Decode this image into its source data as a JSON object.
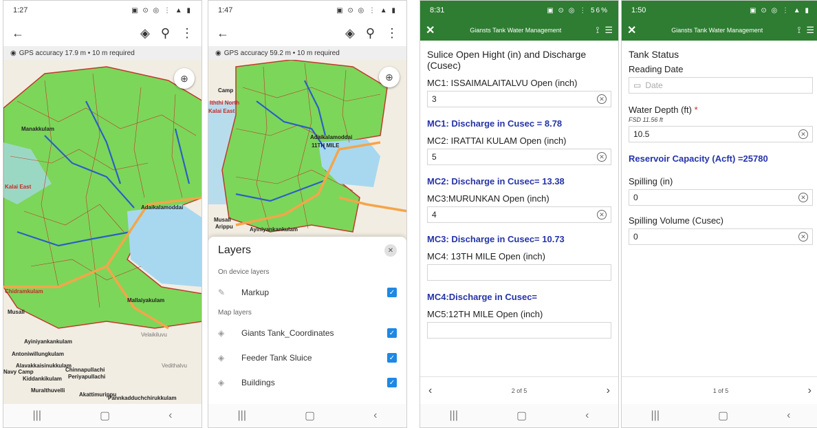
{
  "screen1": {
    "status": {
      "time": "1:27",
      "icons": "▣ ⊙ ◎ ⋮ ▲ ▮"
    },
    "gps": "GPS accuracy 17.9 m  •  10 m required",
    "labels": [
      "Manakkulam",
      "Adaikalamoddai",
      "Musali",
      "Ayiniyankankulam",
      "Antoniwillungkulam",
      "Alavakkaisinukkulam",
      "Navy Camp",
      "Kiddankikulam",
      "Chinnapullachi",
      "Periyapullachi",
      "Vedithalvu",
      "Muralthuvelli",
      "Akattimurippu",
      "Pannkadduchchirukkulam",
      "Velaikiluvu",
      "Mallaiyakulam",
      "Kalai East",
      "Chidramkulam"
    ]
  },
  "screen2": {
    "status": {
      "time": "1:47",
      "icons": "▣ ⊙ ◎ ⋮ ▲ ▮"
    },
    "gps": "GPS accuracy 59.2 m  •  10 m required",
    "labels": [
      "Camp",
      "Iththi North",
      "Kalai East",
      "Adaikalamoddai",
      "11TH MILE",
      "Musali",
      "Arippu",
      "Ayiniyankankulam"
    ],
    "sheet": {
      "title": "Layers",
      "on_device": "On device layers",
      "map_layers": "Map layers",
      "layers": [
        {
          "name": "Markup",
          "icon": "✎"
        },
        {
          "name": "Giants Tank_Coordinates",
          "icon": "◈"
        },
        {
          "name": "Feeder Tank Sluice",
          "icon": "◈"
        },
        {
          "name": "Buildings",
          "icon": "◈"
        }
      ]
    }
  },
  "screen3": {
    "status": {
      "time": "8:31",
      "icons": "▣ ⊙ ◎ ⋮ 56%"
    },
    "appbar": {
      "title": "Giansts Tank Water Management"
    },
    "header": "Sulice Open Hight (in) and Discharge (Cusec)",
    "q1": {
      "label": "MC1: ISSAIMALAITALVU Open (inch)",
      "value": "3"
    },
    "c1": "MC1: Discharge in Cusec = 8.78",
    "q2": {
      "label": "MC2: IRATTAI KULAM Open (inch)",
      "value": "5"
    },
    "c2": "MC2: Discharge in Cusec= 13.38",
    "q3": {
      "label": "MC3:MURUNKAN Open (inch)",
      "value": "4"
    },
    "c3": "MC3: Discharge in Cusec= 10.73",
    "q4": {
      "label": "MC4: 13TH MILE Open (inch)",
      "value": ""
    },
    "c4": "MC4:Discharge in Cusec=",
    "q5": {
      "label": "MC5:12TH MILE Open (inch)",
      "value": ""
    },
    "pager": "2 of 5"
  },
  "screen4": {
    "status": {
      "time": "1:50",
      "icons": "▣ ⊙ ◎ ⋮ ▲ ▮"
    },
    "appbar": {
      "title": "Giansts Tank Water Management"
    },
    "section": "Tank Status",
    "reading_date": {
      "label": "Reading Date",
      "placeholder": "Date"
    },
    "water_depth": {
      "label": "Water Depth (ft)",
      "required": "*",
      "hint": "FSD 11.56 ft",
      "value": "10.5"
    },
    "capacity": "Reservoir Capacity (Acft) =25780",
    "spilling": {
      "label": "Spilling (in)",
      "value": "0"
    },
    "spilling_volume": {
      "label": "Spilling Volume (Cusec)",
      "value": "0"
    },
    "pager": "1 of 5"
  },
  "colors": {
    "green_bar": "#2e7d32",
    "calc_text": "#2533a8",
    "map_green": "#7cd65a",
    "map_water": "#a8d8ef",
    "road": "#f5a54a",
    "river": "#2b5fc4",
    "checkbox": "#1e88e5"
  }
}
